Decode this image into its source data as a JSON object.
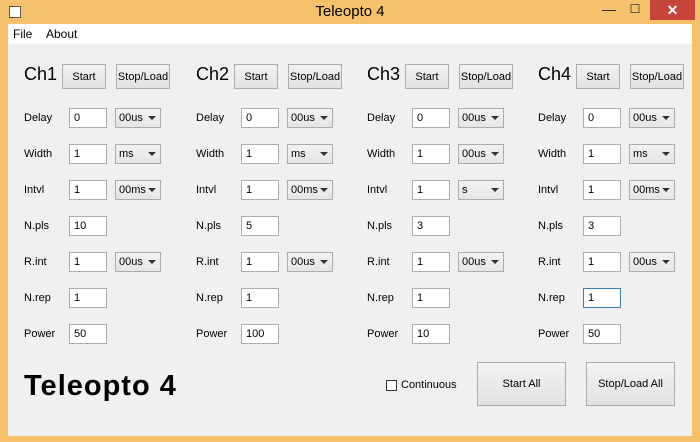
{
  "window": {
    "title": "Teleopto 4",
    "minimize": "—",
    "maximize": "☐",
    "close": "✕"
  },
  "menu": {
    "file": "File",
    "about": "About"
  },
  "labels": {
    "delay": "Delay",
    "width": "Width",
    "intvl": "Intvl",
    "npls": "N.pls",
    "rint": "R.int",
    "nrep": "N.rep",
    "power": "Power"
  },
  "channels": [
    {
      "name": "Ch1",
      "start": "Start",
      "stopload": "Stop/Load",
      "delay": "0",
      "delay_unit": "00us",
      "width": "1",
      "width_unit": "ms",
      "intvl": "1",
      "intvl_unit": "00ms",
      "npls": "10",
      "rint": "1",
      "rint_unit": "00us",
      "nrep": "1",
      "power": "50"
    },
    {
      "name": "Ch2",
      "start": "Start",
      "stopload": "Stop/Load",
      "delay": "0",
      "delay_unit": "00us",
      "width": "1",
      "width_unit": "ms",
      "intvl": "1",
      "intvl_unit": "00ms",
      "npls": "5",
      "rint": "1",
      "rint_unit": "00us",
      "nrep": "1",
      "power": "100"
    },
    {
      "name": "Ch3",
      "start": "Start",
      "stopload": "Stop/Load",
      "delay": "0",
      "delay_unit": "00us",
      "width": "1",
      "width_unit": "00us",
      "intvl": "1",
      "intvl_unit": "s",
      "npls": "3",
      "rint": "1",
      "rint_unit": "00us",
      "nrep": "1",
      "power": "10"
    },
    {
      "name": "Ch4",
      "start": "Start",
      "stopload": "Stop/Load",
      "delay": "0",
      "delay_unit": "00us",
      "width": "1",
      "width_unit": "ms",
      "intvl": "1",
      "intvl_unit": "00ms",
      "npls": "3",
      "rint": "1",
      "rint_unit": "00us",
      "nrep": "1",
      "power": "50"
    }
  ],
  "footer": {
    "app_name": "Teleopto 4",
    "continuous_label": "Continuous",
    "start_all": "Start All",
    "stop_load_all": "Stop/Load All"
  }
}
